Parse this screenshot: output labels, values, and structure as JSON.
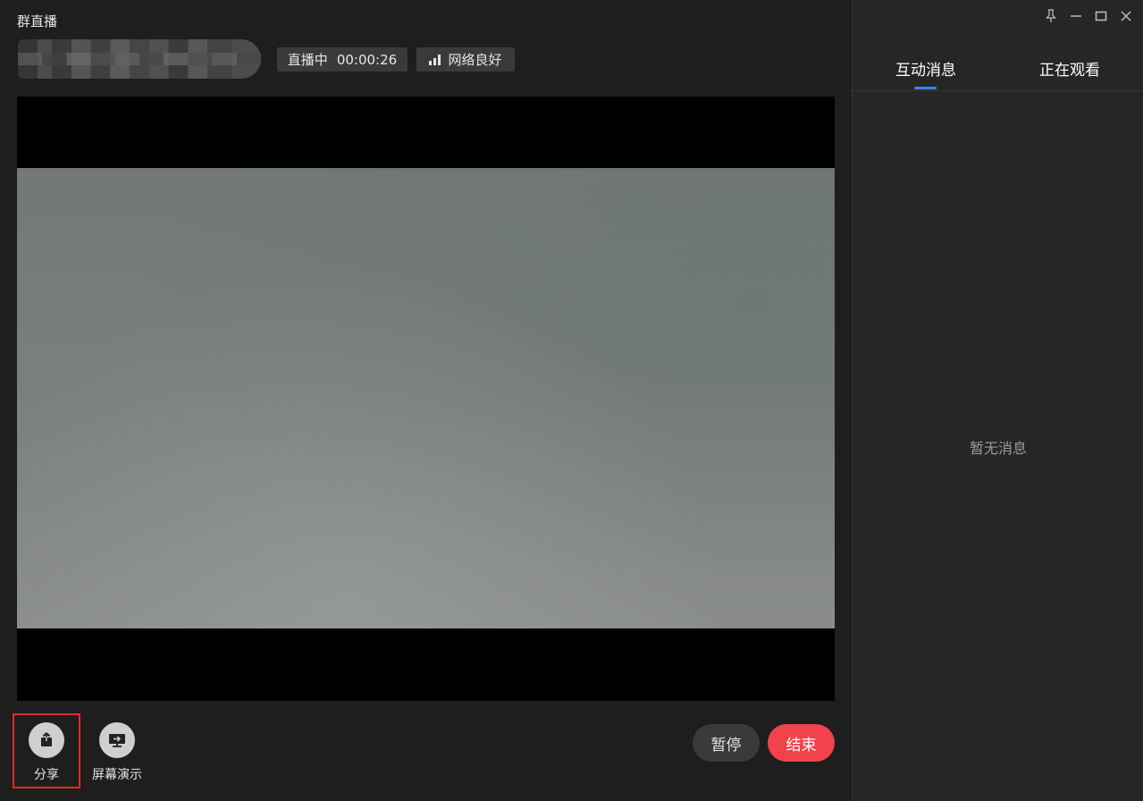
{
  "window": {
    "title": "群直播"
  },
  "header": {
    "host_name": "",
    "live_status": "直播中",
    "live_time": "00:00:26",
    "network_status": "网络良好",
    "network_icon": "signal-bars-icon"
  },
  "toolbar": {
    "share_label": "分享",
    "share_icon": "share-upload-icon",
    "screen_label": "屏幕演示",
    "screen_icon": "screen-share-icon",
    "pause_label": "暂停",
    "end_label": "结束"
  },
  "side": {
    "tabs": [
      {
        "label": "互动消息",
        "active": true
      },
      {
        "label": "正在观看",
        "active": false
      }
    ],
    "empty_text": "暂无消息"
  },
  "window_controls": [
    "pin-icon",
    "minimize-icon",
    "maximize-icon",
    "close-icon"
  ],
  "colors": {
    "accent": "#3b82f6",
    "end_button": "#f2424b",
    "highlight": "#e02a2a"
  }
}
